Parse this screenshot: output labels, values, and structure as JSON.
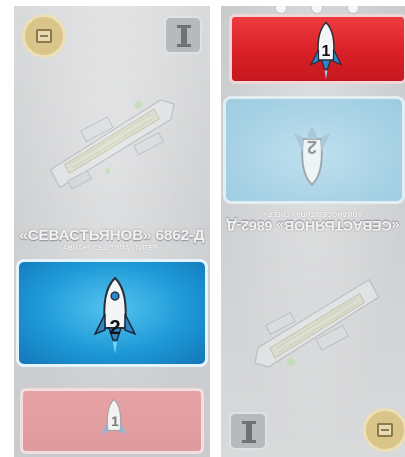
{
  "left_card": {
    "ship_name": "«СЕВАСТЬЯНОВ» 6862-Д",
    "ship_class": "АВИАНОСЕЦ ТИПА «ГИГЕР»",
    "launch_number": "2",
    "bottom_number": "1",
    "top_left_badge_icon": "crate-icon",
    "top_right_badge_icon": "i-beam-icon",
    "panel_color": "#1f9ad8",
    "red_color": "#d71f25"
  },
  "right_card": {
    "ship_name": "«СЕВАСТЬЯНОВ» 6862-Д",
    "ship_class": "АВИАНОСЕЦ ТИПА «ГИГЕР»",
    "launch_number": "1",
    "faded_number": "2",
    "bottom_left_badge_icon": "i-beam-icon",
    "bottom_right_badge_icon": "crate-icon",
    "panel_color": "#d71f25"
  }
}
